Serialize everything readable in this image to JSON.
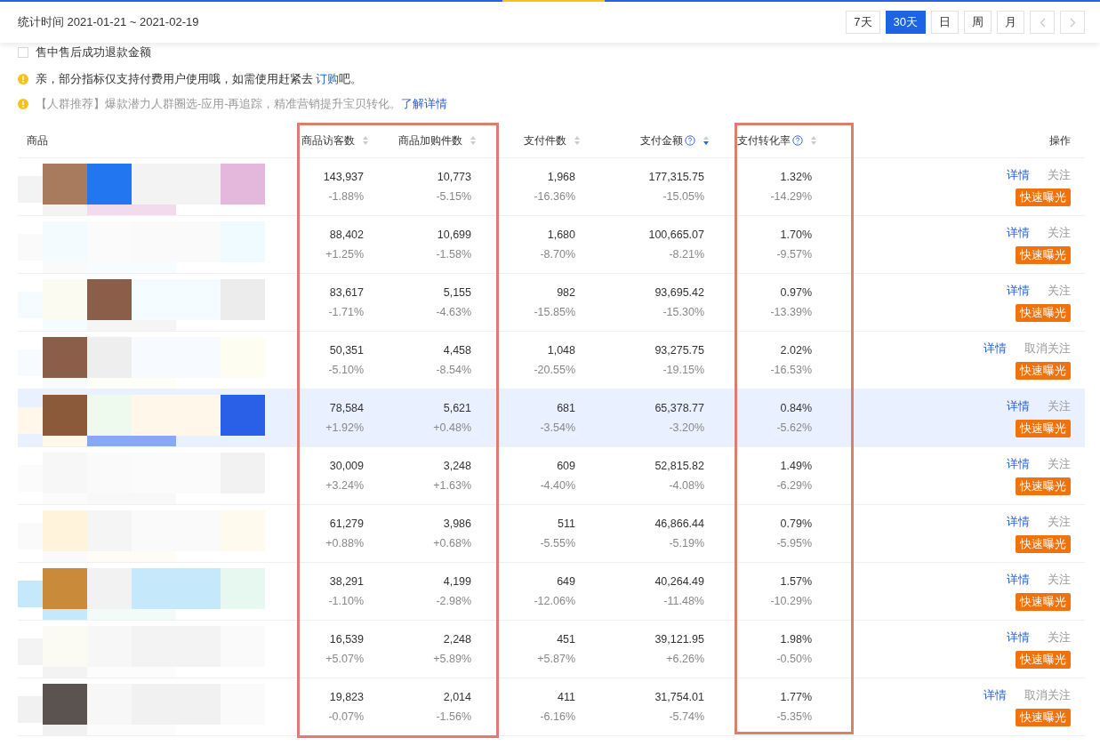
{
  "period": {
    "label": "统计时间 2021-01-21 ~ 2021-02-19"
  },
  "range_buttons": [
    {
      "label": "7天",
      "selected": false
    },
    {
      "label": "30天",
      "selected": true
    },
    {
      "label": "日",
      "selected": false
    },
    {
      "label": "周",
      "selected": false
    },
    {
      "label": "月",
      "selected": false
    }
  ],
  "refund_option": {
    "label": "售中售后成功退款金额",
    "checked": false
  },
  "notices": [
    {
      "text": "亲，部分指标仅支持付费用户使用哦，如需使用赶紧去 ",
      "link": "订购",
      "tail": "吧。",
      "muted": false
    },
    {
      "text": "【人群推荐】爆款潜力人群圈选-应用-再追踪，精准营销提升宝贝转化。",
      "link": "了解详情",
      "muted": true
    }
  ],
  "table": {
    "columns": [
      {
        "label": "商品",
        "kind": "product",
        "help": false
      },
      {
        "label": "商品访客数",
        "kind": "metric",
        "sorted": false,
        "help": false
      },
      {
        "label": "商品加购件数",
        "kind": "metric",
        "sorted": false,
        "help": false
      },
      {
        "label": "支付件数",
        "kind": "metric",
        "sorted": false,
        "help": false
      },
      {
        "label": "支付金额",
        "kind": "metric",
        "sorted": true,
        "help": true
      },
      {
        "label": "支付转化率",
        "kind": "metric",
        "sorted": false,
        "help": true
      },
      {
        "label": "操作",
        "kind": "actions",
        "help": false
      }
    ],
    "rows": [
      {
        "highlighted": false,
        "metrics": [
          [
            "143,937",
            "-1.88%"
          ],
          [
            "10,773",
            "-5.15%"
          ],
          [
            "1,968",
            "-16.36%"
          ],
          [
            "177,315.75",
            "-15.05%"
          ],
          [
            "1.32%",
            "-14.29%"
          ]
        ],
        "detail": "详情",
        "follow": "关注",
        "promote": "快速曝光"
      },
      {
        "highlighted": false,
        "metrics": [
          [
            "88,402",
            "+1.25%"
          ],
          [
            "10,699",
            "-1.58%"
          ],
          [
            "1,680",
            "-8.70%"
          ],
          [
            "100,665.07",
            "-8.21%"
          ],
          [
            "1.70%",
            "-9.57%"
          ]
        ],
        "detail": "详情",
        "follow": "关注",
        "promote": "快速曝光"
      },
      {
        "highlighted": false,
        "metrics": [
          [
            "83,617",
            "-1.71%"
          ],
          [
            "5,155",
            "-4.63%"
          ],
          [
            "982",
            "-15.85%"
          ],
          [
            "93,695.42",
            "-15.30%"
          ],
          [
            "0.97%",
            "-13.39%"
          ]
        ],
        "detail": "详情",
        "follow": "关注",
        "promote": "快速曝光"
      },
      {
        "highlighted": false,
        "metrics": [
          [
            "50,351",
            "-5.10%"
          ],
          [
            "4,458",
            "-8.54%"
          ],
          [
            "1,048",
            "-20.55%"
          ],
          [
            "93,275.75",
            "-19.15%"
          ],
          [
            "2.02%",
            "-16.53%"
          ]
        ],
        "detail": "详情",
        "follow": "取消关注",
        "promote": "快速曝光"
      },
      {
        "highlighted": true,
        "metrics": [
          [
            "78,584",
            "+1.92%"
          ],
          [
            "5,621",
            "+0.48%"
          ],
          [
            "681",
            "-3.54%"
          ],
          [
            "65,378.77",
            "-3.20%"
          ],
          [
            "0.84%",
            "-5.62%"
          ]
        ],
        "detail": "详情",
        "follow": "关注",
        "promote": "快速曝光"
      },
      {
        "highlighted": false,
        "metrics": [
          [
            "30,009",
            "+3.24%"
          ],
          [
            "3,248",
            "+1.63%"
          ],
          [
            "609",
            "-4.40%"
          ],
          [
            "52,815.82",
            "-4.08%"
          ],
          [
            "1.49%",
            "-6.29%"
          ]
        ],
        "detail": "详情",
        "follow": "关注",
        "promote": "快速曝光"
      },
      {
        "highlighted": false,
        "metrics": [
          [
            "61,279",
            "+0.88%"
          ],
          [
            "3,986",
            "+0.68%"
          ],
          [
            "511",
            "-5.55%"
          ],
          [
            "46,866.44",
            "-5.19%"
          ],
          [
            "0.79%",
            "-5.95%"
          ]
        ],
        "detail": "详情",
        "follow": "关注",
        "promote": "快速曝光"
      },
      {
        "highlighted": false,
        "metrics": [
          [
            "38,291",
            "-1.10%"
          ],
          [
            "4,199",
            "-2.98%"
          ],
          [
            "649",
            "-12.06%"
          ],
          [
            "40,264.49",
            "-11.48%"
          ],
          [
            "1.57%",
            "-10.29%"
          ]
        ],
        "detail": "详情",
        "follow": "关注",
        "promote": "快速曝光"
      },
      {
        "highlighted": false,
        "metrics": [
          [
            "16,539",
            "+5.07%"
          ],
          [
            "2,248",
            "+5.89%"
          ],
          [
            "451",
            "+5.87%"
          ],
          [
            "39,121.95",
            "+6.26%"
          ],
          [
            "1.98%",
            "-0.50%"
          ]
        ],
        "detail": "详情",
        "follow": "关注",
        "promote": "快速曝光"
      },
      {
        "highlighted": false,
        "metrics": [
          [
            "19,823",
            "-0.07%"
          ],
          [
            "2,014",
            "-1.56%"
          ],
          [
            "411",
            "-6.16%"
          ],
          [
            "31,754.01",
            "-5.74%"
          ],
          [
            "1.77%",
            "-5.35%"
          ]
        ],
        "detail": "详情",
        "follow": "取消关注",
        "promote": "快速曝光"
      }
    ]
  }
}
